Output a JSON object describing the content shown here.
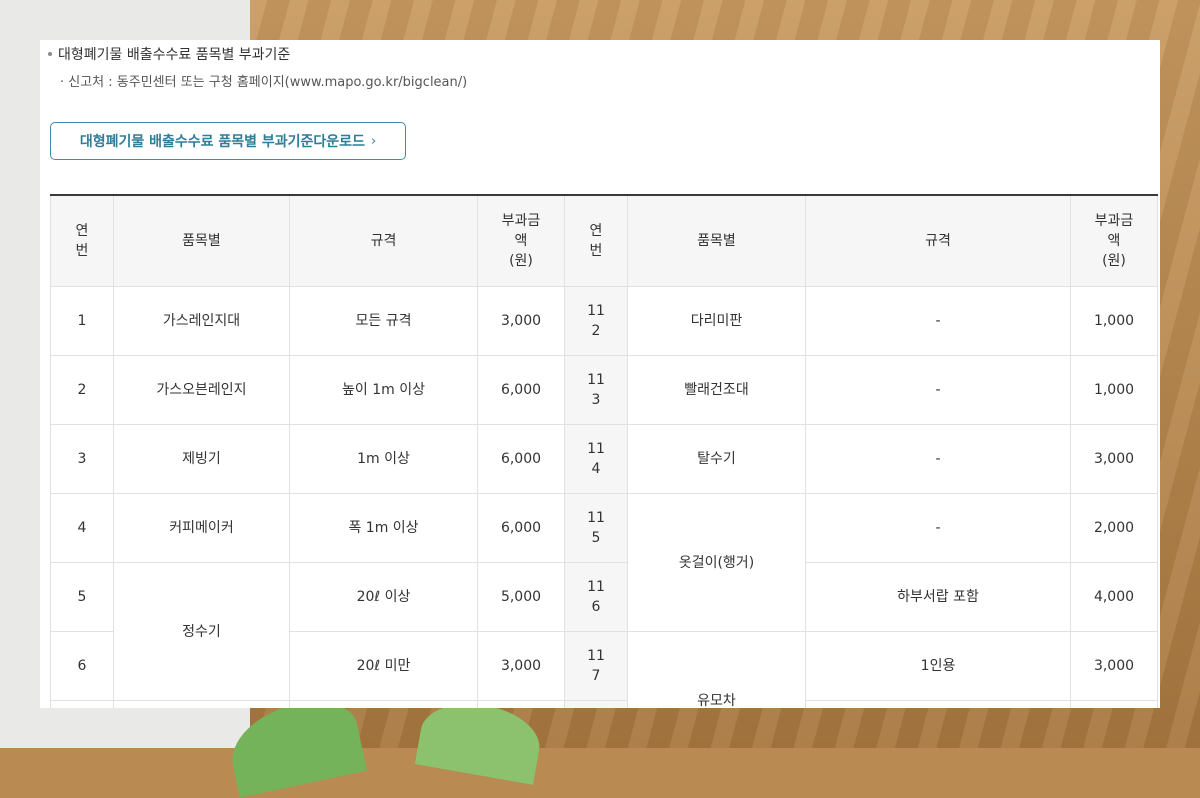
{
  "notice": {
    "title": "대형폐기물 배출수수료 품목별 부과기준",
    "report_label": "· 신고처 : 동주민센터 또는 구청 홈페이지(www.mapo.go.kr/bigclean/)"
  },
  "download": {
    "label": "대형폐기물 배출수수료 품목별 부과기준다운로드",
    "chevron": "›"
  },
  "table": {
    "headers": {
      "no_l1": "연",
      "no_l2": "번",
      "item": "품목별",
      "spec": "규격",
      "fee_l1": "부과금",
      "fee_l2": "액",
      "fee_l3": "(원)"
    },
    "left": [
      {
        "no": "1",
        "item": "가스레인지대",
        "spec": "모든 규격",
        "fee": "3,000"
      },
      {
        "no": "2",
        "item": "가스오븐레인지",
        "spec": "높이 1m 이상",
        "fee": "6,000"
      },
      {
        "no": "3",
        "item": "제빙기",
        "spec": "1m 이상",
        "fee": "6,000"
      },
      {
        "no": "4",
        "item": "커피메이커",
        "spec": "폭 1m 이상",
        "fee": "6,000"
      },
      {
        "no": "5",
        "item": "정수기",
        "spec": "20ℓ 이상",
        "fee": "5,000"
      },
      {
        "no": "6",
        "item": "",
        "spec": "20ℓ 미만",
        "fee": "3,000"
      }
    ],
    "right": [
      {
        "no_l1": "11",
        "no_l2": "2",
        "item": "다리미판",
        "spec": "-",
        "fee": "1,000"
      },
      {
        "no_l1": "11",
        "no_l2": "3",
        "item": "빨래건조대",
        "spec": "-",
        "fee": "1,000"
      },
      {
        "no_l1": "11",
        "no_l2": "4",
        "item": "탈수기",
        "spec": "-",
        "fee": "3,000"
      },
      {
        "no_l1": "11",
        "no_l2": "5",
        "item": "옷걸이(행거)",
        "spec": "-",
        "fee": "2,000"
      },
      {
        "no_l1": "11",
        "no_l2": "6",
        "item": "",
        "spec": "하부서랍 포함",
        "fee": "4,000"
      },
      {
        "no_l1": "11",
        "no_l2": "7",
        "item": "유모차",
        "spec": "1인용",
        "fee": "3,000"
      }
    ]
  }
}
